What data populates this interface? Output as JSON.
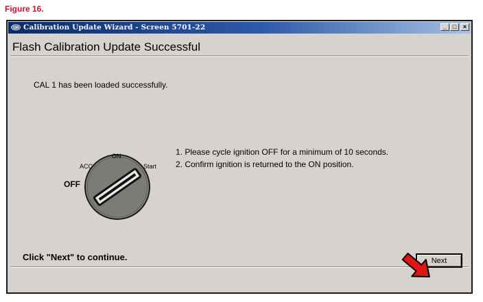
{
  "figure_label": "Figure 16.",
  "window": {
    "title": "Calibration Update Wizard - Screen 5701-22",
    "controls": {
      "minimize": "_",
      "maximize": "□",
      "close": "×"
    }
  },
  "page_title": "Flash Calibration Update Successful",
  "message": "CAL 1 has been loaded successfully.",
  "ignition_diagram": {
    "off_label": "OFF",
    "acc_label": "ACC",
    "on_label": "ON",
    "start_label": "Start"
  },
  "instructions": [
    "1. Please cycle ignition OFF for a minimum of 10 seconds.",
    "2. Confirm ignition is returned to the ON position."
  ],
  "footer_prompt": "Click \"Next\" to continue.",
  "next_button_label": "Next",
  "colors": {
    "figure_label": "#c8102e",
    "arrow": "#e01616",
    "window_bg": "#d6d3ce",
    "titlebar_start": "#0b2a6b",
    "titlebar_end": "#a6c1e6"
  },
  "icons": {
    "app": "app-logo-icon",
    "arrow": "red-arrow-icon",
    "ignition": "ignition-key-icon"
  }
}
